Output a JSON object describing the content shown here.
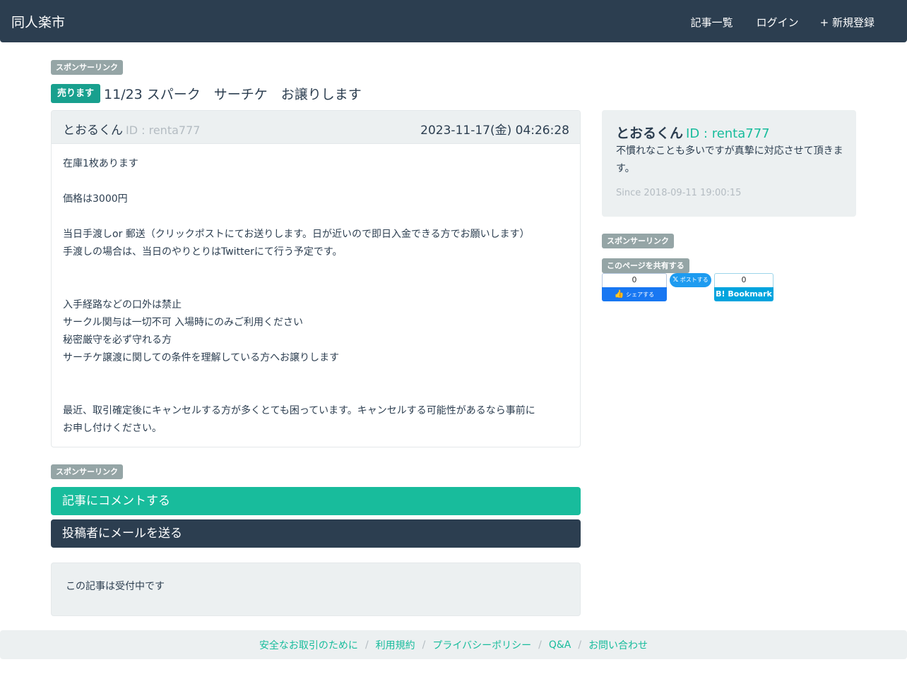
{
  "navbar": {
    "brand": "同人楽市",
    "items": [
      {
        "icon": "list-icon",
        "glyph": "",
        "label": "記事一覧"
      },
      {
        "icon": "login-icon",
        "glyph": "",
        "label": "ログイン"
      },
      {
        "icon": "plus-icon",
        "glyph": "+",
        "label": "新規登録"
      }
    ]
  },
  "sponsor_label": "スポンサーリンク",
  "share_label": "このページを共有する",
  "post": {
    "type_badge": "売ります",
    "title": "11/23 スパーク　サーチケ　お譲りします",
    "author": {
      "icon": "user-icon",
      "glyph": "",
      "name": "とおるくん",
      "id": "ID : renta777"
    },
    "date": {
      "icon": "clock-icon",
      "glyph": "",
      "text": "2023-11-17(金) 04:26:28"
    },
    "body_lines": [
      "在庫1枚あります",
      "",
      "価格は3000円",
      "",
      "当日手渡しor 郵送（クリックポストにてお送りします。日が近いので即日入金できる方でお願いします）",
      "手渡しの場合は、当日のやりとりはTwitterにて行う予定です。",
      "",
      "",
      "入手経路などの口外は禁止",
      "サークル関与は一切不可 入場時にのみご利用ください",
      "秘密厳守を必ず守れる方",
      "サーチケ譲渡に関しての条件を理解している方へお譲りします",
      "",
      "",
      "最近、取引確定後にキャンセルする方が多くとても困っています。キャンセルする可能性があるなら事前に",
      "お申し付けください。"
    ]
  },
  "buttons": {
    "comment": "記事にコメントする",
    "mail": "投稿者にメールを送る"
  },
  "status": "この記事は受付中です",
  "profile": {
    "glyph": "",
    "name": "とおるくん",
    "id": "ID : renta777",
    "description": "不慣れなことも多いですが真摯に対応させて頂きます。",
    "since_glyph": "",
    "since": "Since 2018-09-11 19:00:15"
  },
  "share": {
    "facebook": {
      "count": "0",
      "label": "シェアする"
    },
    "twitter": {
      "label": "ポストする"
    },
    "hatena": {
      "count": "0",
      "label": "B! Bookmark"
    }
  },
  "footer": {
    "links": [
      "安全なお取引のために",
      "利用規約",
      "プライバシーポリシー",
      "Q&A",
      "お問い合わせ"
    ],
    "separator": "/"
  },
  "colors": {
    "navbar": "#2c3e50",
    "accent": "#18bc9c",
    "badge": "#18a08e",
    "muted": "#95a5a6",
    "panel": "#ecf0f1"
  }
}
